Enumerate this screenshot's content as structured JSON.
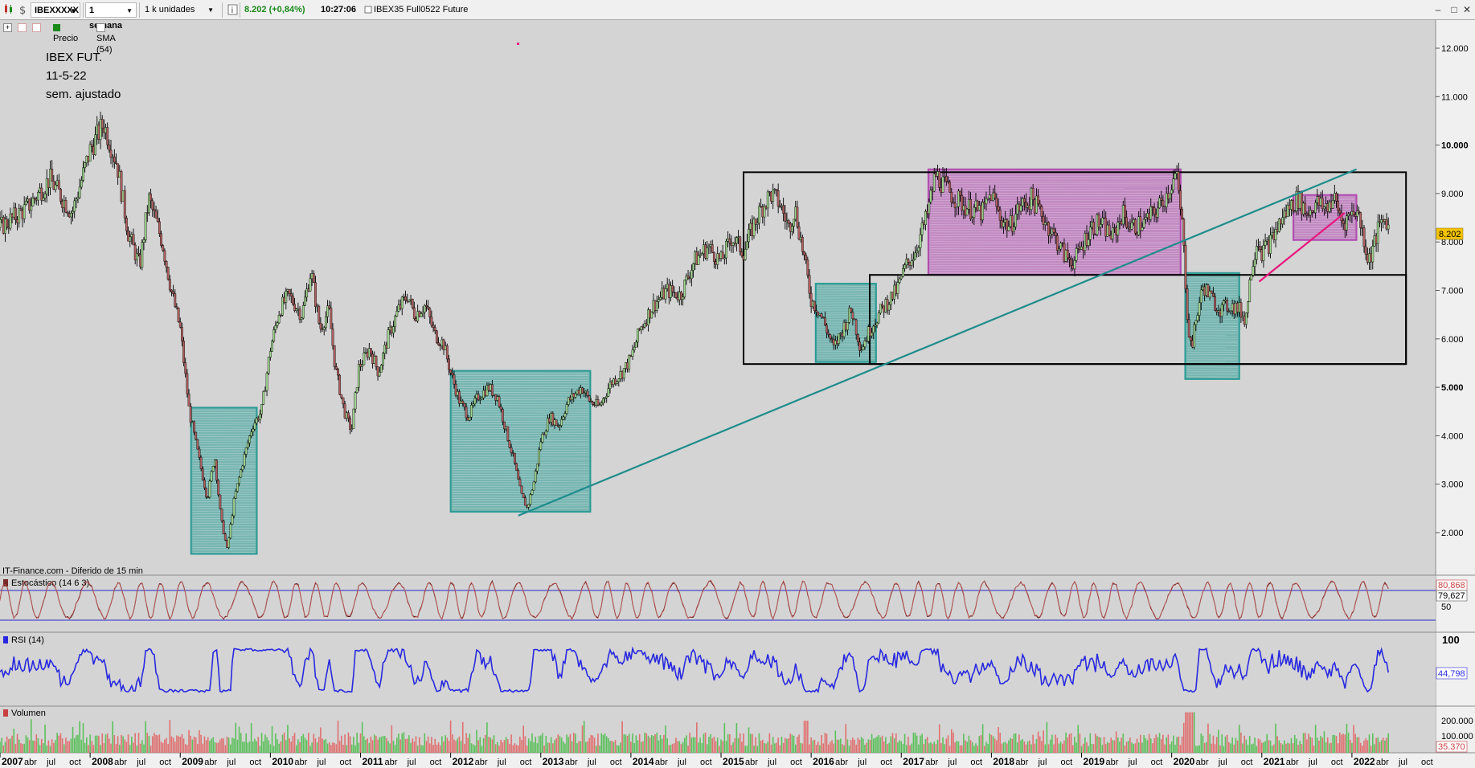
{
  "toolbar": {
    "symbol": "IBEXXXXX",
    "period": "1 semana",
    "units": "1 k unidades",
    "info_icon": "i",
    "price_change": "8.202 (+0,84%)",
    "time": "10:27:06",
    "instrument": "IBEX35 Full0522 Future"
  },
  "subbar": {
    "price_label": "Precio",
    "sma_label": "SMA (54)"
  },
  "annotation": {
    "line1": "IBEX FUT.",
    "line2": "11-5-22",
    "line3": "sem. ajustado"
  },
  "source_note": "IT-Finance.com - Diferido de 15 min",
  "price_axis": {
    "ticks": [
      "12.000",
      "11.000",
      "10.000",
      "9.000",
      "8.000",
      "7.000",
      "6.000",
      "5.000",
      "4.000",
      "3.000",
      "2.000"
    ],
    "current_label": "8.202"
  },
  "stoch": {
    "title": "Estocástico (14 6 3)",
    "value1": "80,868",
    "value2": "79,627",
    "tick_50": "50"
  },
  "rsi": {
    "title": "RSI (14)",
    "value": "44,798",
    "tick_100": "100"
  },
  "volume": {
    "title": "Volumen",
    "tick_200k": "200.000",
    "tick_100k": "100.000",
    "value": "35.370"
  },
  "x_axis": {
    "labels": [
      {
        "t": "2007",
        "y": true
      },
      {
        "t": "abr"
      },
      {
        "t": "jul"
      },
      {
        "t": "oct"
      },
      {
        "t": "2008",
        "y": true
      },
      {
        "t": "abr"
      },
      {
        "t": "jul"
      },
      {
        "t": "oct"
      },
      {
        "t": "2009",
        "y": true
      },
      {
        "t": "abr"
      },
      {
        "t": "jul"
      },
      {
        "t": "oct"
      },
      {
        "t": "2010",
        "y": true
      },
      {
        "t": "abr"
      },
      {
        "t": "jul"
      },
      {
        "t": "oct"
      },
      {
        "t": "2011",
        "y": true
      },
      {
        "t": "abr"
      },
      {
        "t": "jul"
      },
      {
        "t": "oct"
      },
      {
        "t": "2012",
        "y": true
      },
      {
        "t": "abr"
      },
      {
        "t": "jul"
      },
      {
        "t": "oct"
      },
      {
        "t": "2013",
        "y": true
      },
      {
        "t": "abr"
      },
      {
        "t": "jul"
      },
      {
        "t": "oct"
      },
      {
        "t": "2014",
        "y": true
      },
      {
        "t": "abr"
      },
      {
        "t": "jul"
      },
      {
        "t": "oct"
      },
      {
        "t": "2015",
        "y": true
      },
      {
        "t": "abr"
      },
      {
        "t": "jul"
      },
      {
        "t": "oct"
      },
      {
        "t": "2016",
        "y": true
      },
      {
        "t": "abr"
      },
      {
        "t": "jul"
      },
      {
        "t": "oct"
      },
      {
        "t": "2017",
        "y": true
      },
      {
        "t": "abr"
      },
      {
        "t": "jul"
      },
      {
        "t": "oct"
      },
      {
        "t": "2018",
        "y": true
      },
      {
        "t": "abr"
      },
      {
        "t": "jul"
      },
      {
        "t": "oct"
      },
      {
        "t": "2019",
        "y": true
      },
      {
        "t": "abr"
      },
      {
        "t": "jul"
      },
      {
        "t": "oct"
      },
      {
        "t": "2020",
        "y": true
      },
      {
        "t": "abr"
      },
      {
        "t": "jul"
      },
      {
        "t": "oct"
      },
      {
        "t": "2021",
        "y": true
      },
      {
        "t": "abr"
      },
      {
        "t": "jul"
      },
      {
        "t": "oct"
      },
      {
        "t": "2022",
        "y": true
      },
      {
        "t": "abr"
      },
      {
        "t": "jul"
      },
      {
        "t": "oct"
      }
    ]
  },
  "colors": {
    "background": "#d4d4d4",
    "teal_box": "#2a9a94",
    "purple_box": "#b04ab0",
    "trend_teal": "#1e8c8c",
    "trend_pink": "#e8177d",
    "stoch_line": "#7a2a2a",
    "rsi_line": "#2828e0",
    "price_tag": "#f5c400"
  },
  "chart_data": {
    "type": "line",
    "title": "",
    "ylabel": "",
    "xlabel": "",
    "x_range": [
      "2007-01",
      "2022-10"
    ],
    "ylim": [
      1500,
      12600
    ],
    "series": [
      {
        "values": [
          [
            2007.0,
            8300
          ],
          [
            2007.3,
            8700
          ],
          [
            2007.55,
            9300
          ],
          [
            2007.8,
            8600
          ],
          [
            2008.0,
            9900
          ],
          [
            2008.15,
            10450
          ],
          [
            2008.3,
            9600
          ],
          [
            2008.42,
            8200
          ],
          [
            2008.55,
            7500
          ],
          [
            2008.65,
            8900
          ],
          [
            2008.8,
            8000
          ],
          [
            2008.9,
            7000
          ],
          [
            2009.0,
            6200
          ],
          [
            2009.1,
            4500
          ],
          [
            2009.2,
            3600
          ],
          [
            2009.3,
            2700
          ],
          [
            2009.38,
            3600
          ],
          [
            2009.45,
            2300
          ],
          [
            2009.52,
            1650
          ],
          [
            2009.6,
            2700
          ],
          [
            2009.7,
            3500
          ],
          [
            2009.8,
            4200
          ],
          [
            2009.9,
            4500
          ],
          [
            2010.0,
            5800
          ],
          [
            2010.1,
            6600
          ],
          [
            2010.2,
            6900
          ],
          [
            2010.35,
            6500
          ],
          [
            2010.45,
            7400
          ],
          [
            2010.55,
            6200
          ],
          [
            2010.65,
            6600
          ],
          [
            2010.72,
            5400
          ],
          [
            2010.82,
            4500
          ],
          [
            2010.9,
            4100
          ],
          [
            2010.98,
            5400
          ],
          [
            2011.1,
            5800
          ],
          [
            2011.2,
            5300
          ],
          [
            2011.3,
            6000
          ],
          [
            2011.42,
            6600
          ],
          [
            2011.52,
            6900
          ],
          [
            2011.6,
            6500
          ],
          [
            2011.72,
            6700
          ],
          [
            2011.82,
            6100
          ],
          [
            2011.92,
            5900
          ],
          [
            2012.0,
            5300
          ],
          [
            2012.1,
            4700
          ],
          [
            2012.2,
            4400
          ],
          [
            2012.3,
            4800
          ],
          [
            2012.42,
            5000
          ],
          [
            2012.52,
            4800
          ],
          [
            2012.6,
            4200
          ],
          [
            2012.7,
            3500
          ],
          [
            2012.78,
            2800
          ],
          [
            2012.85,
            2500
          ],
          [
            2012.93,
            3100
          ],
          [
            2013.0,
            3900
          ],
          [
            2013.1,
            4400
          ],
          [
            2013.2,
            4200
          ],
          [
            2013.3,
            4700
          ],
          [
            2013.45,
            5000
          ],
          [
            2013.55,
            4700
          ],
          [
            2013.65,
            4600
          ],
          [
            2013.78,
            5100
          ],
          [
            2013.9,
            5300
          ],
          [
            2014.0,
            5600
          ],
          [
            2014.1,
            6200
          ],
          [
            2014.25,
            6700
          ],
          [
            2014.4,
            7000
          ],
          [
            2014.55,
            6900
          ],
          [
            2014.7,
            7600
          ],
          [
            2014.85,
            7900
          ],
          [
            2015.0,
            7600
          ],
          [
            2015.12,
            8100
          ],
          [
            2015.25,
            7800
          ],
          [
            2015.35,
            8300
          ],
          [
            2015.45,
            8700
          ],
          [
            2015.55,
            9000
          ],
          [
            2015.65,
            8800
          ],
          [
            2015.75,
            8300
          ],
          [
            2015.82,
            8700
          ],
          [
            2015.92,
            7700
          ],
          [
            2016.0,
            6800
          ],
          [
            2016.08,
            6600
          ],
          [
            2016.15,
            6300
          ],
          [
            2016.25,
            5800
          ],
          [
            2016.35,
            6200
          ],
          [
            2016.45,
            6600
          ],
          [
            2016.55,
            5800
          ],
          [
            2016.68,
            6300
          ],
          [
            2016.82,
            6700
          ],
          [
            2016.95,
            7000
          ],
          [
            2017.05,
            7500
          ],
          [
            2017.15,
            7800
          ],
          [
            2017.28,
            8500
          ],
          [
            2017.38,
            9400
          ],
          [
            2017.5,
            9100
          ],
          [
            2017.6,
            8900
          ],
          [
            2017.75,
            8700
          ],
          [
            2017.9,
            8600
          ],
          [
            2018.0,
            9000
          ],
          [
            2018.1,
            8500
          ],
          [
            2018.2,
            8300
          ],
          [
            2018.3,
            8700
          ],
          [
            2018.45,
            8900
          ],
          [
            2018.55,
            8600
          ],
          [
            2018.7,
            8100
          ],
          [
            2018.82,
            7700
          ],
          [
            2018.92,
            7600
          ],
          [
            2019.0,
            7900
          ],
          [
            2019.1,
            8300
          ],
          [
            2019.2,
            8400
          ],
          [
            2019.35,
            8100
          ],
          [
            2019.45,
            8600
          ],
          [
            2019.55,
            8300
          ],
          [
            2019.7,
            8400
          ],
          [
            2019.85,
            8700
          ],
          [
            2019.95,
            9000
          ],
          [
            2020.05,
            9400
          ],
          [
            2020.12,
            8300
          ],
          [
            2020.18,
            6300
          ],
          [
            2020.22,
            5800
          ],
          [
            2020.28,
            6500
          ],
          [
            2020.35,
            7100
          ],
          [
            2020.45,
            6800
          ],
          [
            2020.55,
            6600
          ],
          [
            2020.65,
            6700
          ],
          [
            2020.75,
            6600
          ],
          [
            2020.82,
            6400
          ],
          [
            2020.88,
            7400
          ],
          [
            2020.95,
            8100
          ],
          [
            2021.0,
            7800
          ],
          [
            2021.1,
            8000
          ],
          [
            2021.2,
            8400
          ],
          [
            2021.3,
            8700
          ],
          [
            2021.4,
            8900
          ],
          [
            2021.5,
            8600
          ],
          [
            2021.6,
            8800
          ],
          [
            2021.7,
            8700
          ],
          [
            2021.8,
            8900
          ],
          [
            2021.9,
            8400
          ],
          [
            2021.95,
            8500
          ],
          [
            2022.05,
            8700
          ],
          [
            2022.12,
            8200
          ],
          [
            2022.18,
            7600
          ],
          [
            2022.22,
            7800
          ],
          [
            2022.3,
            8300
          ],
          [
            2022.38,
            8500
          ],
          [
            2022.42,
            8200
          ]
        ]
      }
    ],
    "annotations": {
      "teal_boxes": [
        {
          "x": [
            2009.12,
            2009.85
          ],
          "y": [
            1560,
            4580
          ]
        },
        {
          "x": [
            2012.0,
            2013.55
          ],
          "y": [
            2430,
            5340
          ]
        },
        {
          "x": [
            2016.05,
            2016.72
          ],
          "y": [
            5520,
            7140
          ]
        },
        {
          "x": [
            2020.15,
            2020.75
          ],
          "y": [
            5170,
            7360
          ]
        }
      ],
      "purple_boxes": [
        {
          "x": [
            2017.3,
            2020.1
          ],
          "y": [
            7320,
            9500
          ]
        },
        {
          "x": [
            2021.35,
            2022.05
          ],
          "y": [
            8040,
            8970
          ]
        }
      ],
      "black_boxes": [
        {
          "x": [
            2015.25,
            2022.6
          ],
          "y": [
            5480,
            9440
          ]
        },
        {
          "x": [
            2016.65,
            2022.6
          ],
          "y": [
            5480,
            7320
          ]
        }
      ],
      "trendlines": [
        {
          "color": "teal",
          "from": [
            2012.75,
            2350
          ],
          "to": [
            2022.05,
            9500
          ]
        },
        {
          "color": "pink",
          "from": [
            2020.97,
            7180
          ],
          "to": [
            2021.92,
            8600
          ]
        }
      ]
    }
  }
}
